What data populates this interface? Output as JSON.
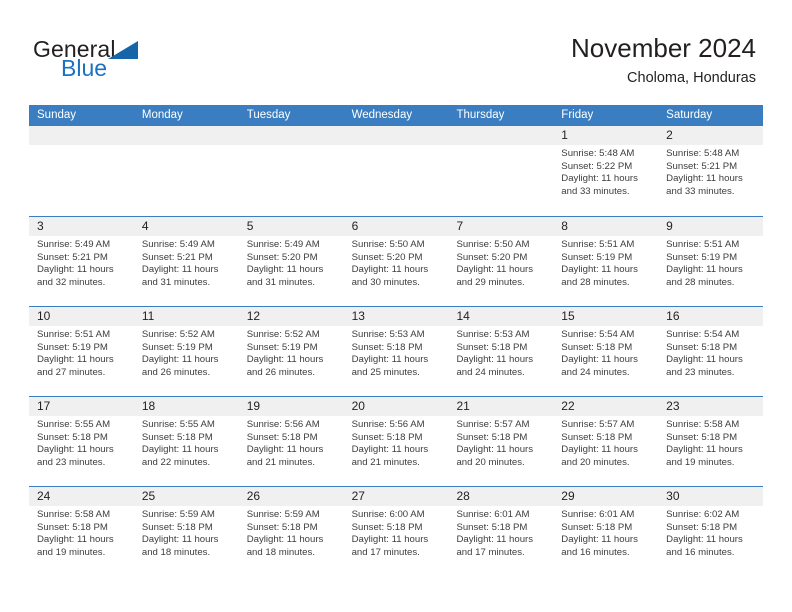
{
  "brand": {
    "name_primary": "General",
    "name_secondary": "Blue"
  },
  "header": {
    "title": "November 2024",
    "subtitle": "Choloma, Honduras"
  },
  "calendar": {
    "weekday_headers": [
      "Sunday",
      "Monday",
      "Tuesday",
      "Wednesday",
      "Thursday",
      "Friday",
      "Saturday"
    ],
    "accent_color": "#3a7ec1",
    "datebar_color": "#f0f0f0",
    "weeks": [
      [
        {
          "date": "",
          "empty": true
        },
        {
          "date": "",
          "empty": true
        },
        {
          "date": "",
          "empty": true
        },
        {
          "date": "",
          "empty": true
        },
        {
          "date": "",
          "empty": true
        },
        {
          "date": "1",
          "sunrise": "Sunrise: 5:48 AM",
          "sunset": "Sunset: 5:22 PM",
          "daylight": "Daylight: 11 hours and 33 minutes."
        },
        {
          "date": "2",
          "sunrise": "Sunrise: 5:48 AM",
          "sunset": "Sunset: 5:21 PM",
          "daylight": "Daylight: 11 hours and 33 minutes."
        }
      ],
      [
        {
          "date": "3",
          "sunrise": "Sunrise: 5:49 AM",
          "sunset": "Sunset: 5:21 PM",
          "daylight": "Daylight: 11 hours and 32 minutes."
        },
        {
          "date": "4",
          "sunrise": "Sunrise: 5:49 AM",
          "sunset": "Sunset: 5:21 PM",
          "daylight": "Daylight: 11 hours and 31 minutes."
        },
        {
          "date": "5",
          "sunrise": "Sunrise: 5:49 AM",
          "sunset": "Sunset: 5:20 PM",
          "daylight": "Daylight: 11 hours and 31 minutes."
        },
        {
          "date": "6",
          "sunrise": "Sunrise: 5:50 AM",
          "sunset": "Sunset: 5:20 PM",
          "daylight": "Daylight: 11 hours and 30 minutes."
        },
        {
          "date": "7",
          "sunrise": "Sunrise: 5:50 AM",
          "sunset": "Sunset: 5:20 PM",
          "daylight": "Daylight: 11 hours and 29 minutes."
        },
        {
          "date": "8",
          "sunrise": "Sunrise: 5:51 AM",
          "sunset": "Sunset: 5:19 PM",
          "daylight": "Daylight: 11 hours and 28 minutes."
        },
        {
          "date": "9",
          "sunrise": "Sunrise: 5:51 AM",
          "sunset": "Sunset: 5:19 PM",
          "daylight": "Daylight: 11 hours and 28 minutes."
        }
      ],
      [
        {
          "date": "10",
          "sunrise": "Sunrise: 5:51 AM",
          "sunset": "Sunset: 5:19 PM",
          "daylight": "Daylight: 11 hours and 27 minutes."
        },
        {
          "date": "11",
          "sunrise": "Sunrise: 5:52 AM",
          "sunset": "Sunset: 5:19 PM",
          "daylight": "Daylight: 11 hours and 26 minutes."
        },
        {
          "date": "12",
          "sunrise": "Sunrise: 5:52 AM",
          "sunset": "Sunset: 5:19 PM",
          "daylight": "Daylight: 11 hours and 26 minutes."
        },
        {
          "date": "13",
          "sunrise": "Sunrise: 5:53 AM",
          "sunset": "Sunset: 5:18 PM",
          "daylight": "Daylight: 11 hours and 25 minutes."
        },
        {
          "date": "14",
          "sunrise": "Sunrise: 5:53 AM",
          "sunset": "Sunset: 5:18 PM",
          "daylight": "Daylight: 11 hours and 24 minutes."
        },
        {
          "date": "15",
          "sunrise": "Sunrise: 5:54 AM",
          "sunset": "Sunset: 5:18 PM",
          "daylight": "Daylight: 11 hours and 24 minutes."
        },
        {
          "date": "16",
          "sunrise": "Sunrise: 5:54 AM",
          "sunset": "Sunset: 5:18 PM",
          "daylight": "Daylight: 11 hours and 23 minutes."
        }
      ],
      [
        {
          "date": "17",
          "sunrise": "Sunrise: 5:55 AM",
          "sunset": "Sunset: 5:18 PM",
          "daylight": "Daylight: 11 hours and 23 minutes."
        },
        {
          "date": "18",
          "sunrise": "Sunrise: 5:55 AM",
          "sunset": "Sunset: 5:18 PM",
          "daylight": "Daylight: 11 hours and 22 minutes."
        },
        {
          "date": "19",
          "sunrise": "Sunrise: 5:56 AM",
          "sunset": "Sunset: 5:18 PM",
          "daylight": "Daylight: 11 hours and 21 minutes."
        },
        {
          "date": "20",
          "sunrise": "Sunrise: 5:56 AM",
          "sunset": "Sunset: 5:18 PM",
          "daylight": "Daylight: 11 hours and 21 minutes."
        },
        {
          "date": "21",
          "sunrise": "Sunrise: 5:57 AM",
          "sunset": "Sunset: 5:18 PM",
          "daylight": "Daylight: 11 hours and 20 minutes."
        },
        {
          "date": "22",
          "sunrise": "Sunrise: 5:57 AM",
          "sunset": "Sunset: 5:18 PM",
          "daylight": "Daylight: 11 hours and 20 minutes."
        },
        {
          "date": "23",
          "sunrise": "Sunrise: 5:58 AM",
          "sunset": "Sunset: 5:18 PM",
          "daylight": "Daylight: 11 hours and 19 minutes."
        }
      ],
      [
        {
          "date": "24",
          "sunrise": "Sunrise: 5:58 AM",
          "sunset": "Sunset: 5:18 PM",
          "daylight": "Daylight: 11 hours and 19 minutes."
        },
        {
          "date": "25",
          "sunrise": "Sunrise: 5:59 AM",
          "sunset": "Sunset: 5:18 PM",
          "daylight": "Daylight: 11 hours and 18 minutes."
        },
        {
          "date": "26",
          "sunrise": "Sunrise: 5:59 AM",
          "sunset": "Sunset: 5:18 PM",
          "daylight": "Daylight: 11 hours and 18 minutes."
        },
        {
          "date": "27",
          "sunrise": "Sunrise: 6:00 AM",
          "sunset": "Sunset: 5:18 PM",
          "daylight": "Daylight: 11 hours and 17 minutes."
        },
        {
          "date": "28",
          "sunrise": "Sunrise: 6:01 AM",
          "sunset": "Sunset: 5:18 PM",
          "daylight": "Daylight: 11 hours and 17 minutes."
        },
        {
          "date": "29",
          "sunrise": "Sunrise: 6:01 AM",
          "sunset": "Sunset: 5:18 PM",
          "daylight": "Daylight: 11 hours and 16 minutes."
        },
        {
          "date": "30",
          "sunrise": "Sunrise: 6:02 AM",
          "sunset": "Sunset: 5:18 PM",
          "daylight": "Daylight: 11 hours and 16 minutes."
        }
      ]
    ]
  }
}
